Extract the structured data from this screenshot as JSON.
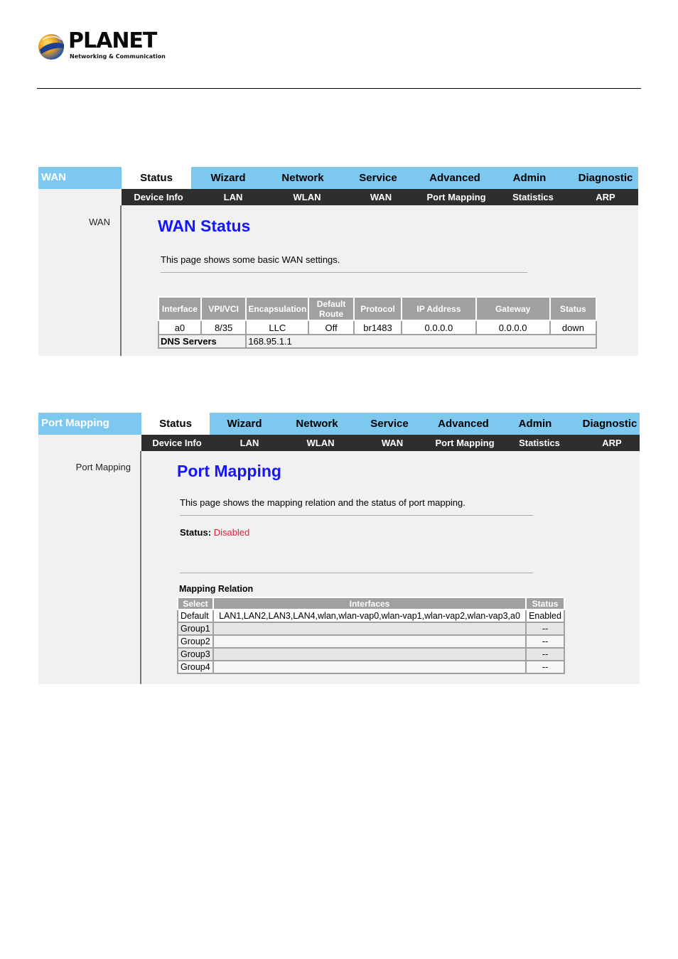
{
  "header": {
    "brand": "PLANET",
    "tagline": "Networking & Communication"
  },
  "nav": {
    "tabs": [
      "Status",
      "Wizard",
      "Network",
      "Service",
      "Advanced",
      "Admin",
      "Diagnostic"
    ],
    "subtabs": [
      "Device Info",
      "LAN",
      "WLAN",
      "WAN",
      "Port Mapping",
      "Statistics",
      "ARP"
    ]
  },
  "colors": {
    "topbar": "#7cc8ef",
    "subbar": "#2e2e2e",
    "title": "#1515ff",
    "disabled": "#e0203a"
  },
  "wan_panel": {
    "section": "WAN",
    "sidebar_item": "WAN",
    "title": "WAN Status",
    "description": "This page shows some basic WAN settings.",
    "table": {
      "headers": [
        "Interface",
        "VPI/VCI",
        "Encapsulation",
        "Default Route",
        "Protocol",
        "IP Address",
        "Gateway",
        "Status"
      ],
      "row": [
        "a0",
        "8/35",
        "LLC",
        "Off",
        "br1483",
        "0.0.0.0",
        "0.0.0.0",
        "down"
      ],
      "dns_label": "DNS Servers",
      "dns_value": "168.95.1.1"
    }
  },
  "pm_panel": {
    "section": "Port Mapping",
    "sidebar_item": "Port Mapping",
    "title": "Port Mapping",
    "description": "This page shows the mapping relation and the status of port mapping.",
    "status_label": "Status:",
    "status_value": "Disabled",
    "mapping_label": "Mapping Relation",
    "table": {
      "headers": [
        "Select",
        "Interfaces",
        "Status"
      ],
      "rows": [
        [
          "Default",
          "LAN1,LAN2,LAN3,LAN4,wlan,wlan-vap0,wlan-vap1,wlan-vap2,wlan-vap3,a0",
          "Enabled"
        ],
        [
          "Group1",
          "",
          "--"
        ],
        [
          "Group2",
          "",
          "--"
        ],
        [
          "Group3",
          "",
          "--"
        ],
        [
          "Group4",
          "",
          "--"
        ]
      ]
    }
  }
}
